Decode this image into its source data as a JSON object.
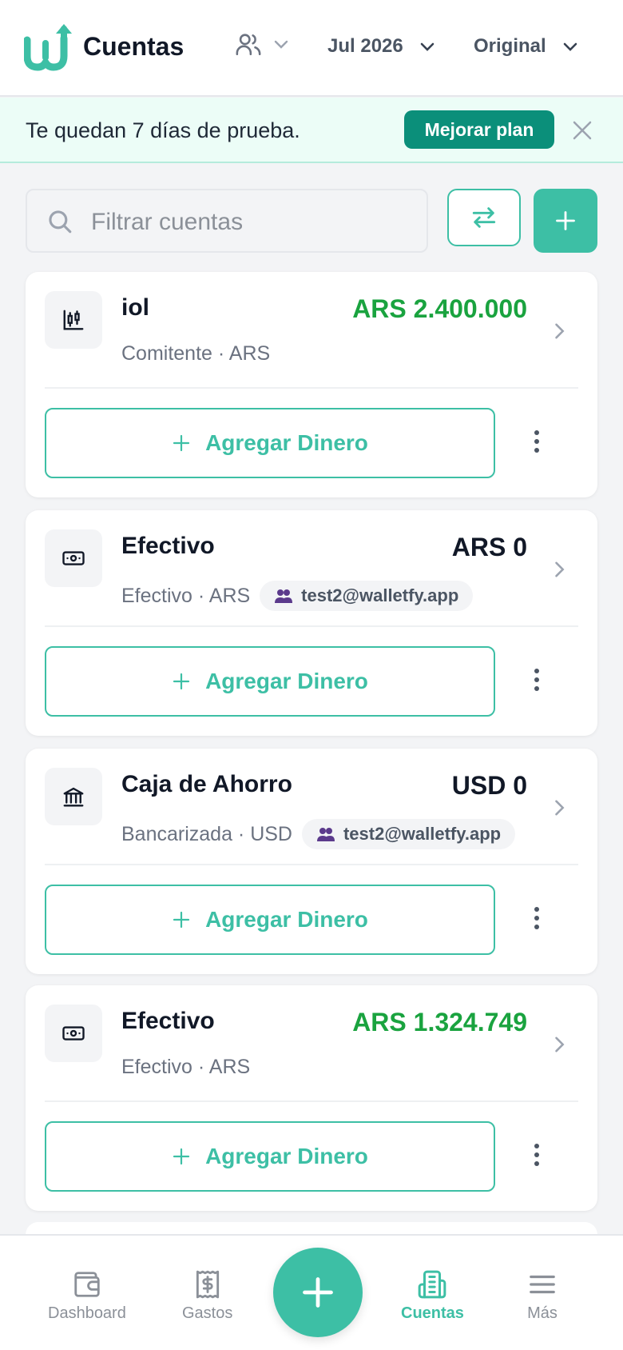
{
  "header": {
    "title": "Cuentas",
    "month": "Jul 2026",
    "currency_view": "Original"
  },
  "trial": {
    "text": "Te quedan 7 días de prueba.",
    "upgrade_label": "Mejorar plan"
  },
  "search": {
    "placeholder": "Filtrar cuentas"
  },
  "accounts": [
    {
      "name": "iol",
      "subtitle": "Comitente · ARS",
      "amount": "ARS 2.400.000",
      "icon": "candlestick-chart-icon",
      "shared_with": ""
    },
    {
      "name": "Efectivo",
      "subtitle": "Efectivo · ARS",
      "amount": "ARS 0",
      "icon": "banknote-icon",
      "shared_with": "test2@walletfy.app"
    },
    {
      "name": "Caja de Ahorro",
      "subtitle": "Bancarizada · USD",
      "amount": "USD 0",
      "icon": "bank-icon",
      "shared_with": "test2@walletfy.app"
    },
    {
      "name": "Efectivo",
      "subtitle": "Efectivo · ARS",
      "amount": "ARS 1.324.749",
      "icon": "banknote-icon",
      "shared_with": ""
    }
  ],
  "add_money_label": "Agregar Dinero",
  "nav": {
    "dashboard": "Dashboard",
    "gastos": "Gastos",
    "cuentas": "Cuentas",
    "mas": "Más"
  },
  "colors": {
    "accent": "#3dbfa5",
    "accent_dark": "#0b8f7a",
    "positive": "#1aa33f",
    "trial_bg": "#ecfdf7"
  }
}
